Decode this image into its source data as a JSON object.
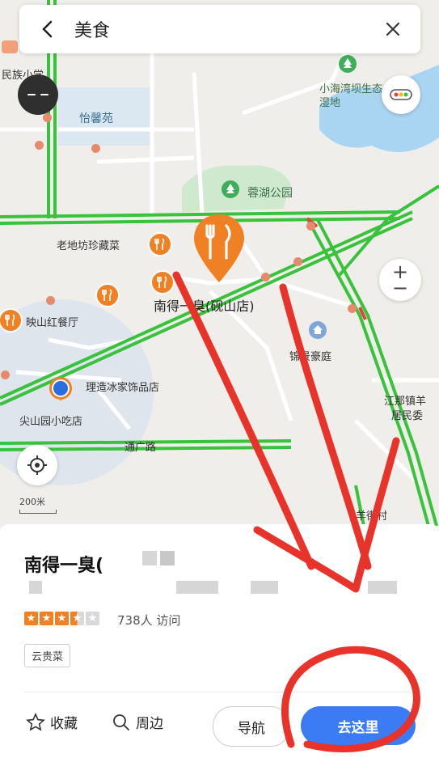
{
  "search": {
    "query": "美食"
  },
  "map": {
    "labels": {
      "school": "民族小学",
      "park_area": "怡馨苑",
      "wetland": "小海湾坝生态湿地",
      "lake_park": "蓉湖公园",
      "restaurant1": "老地坊珍藏菜",
      "selected": "南得一臭(砚山店)",
      "restaurant2": "映山红餐厅",
      "residence": "锦景豪庭",
      "shop": "理造冰家饰品店",
      "snack": "尖山园小吃店",
      "road": "通广路",
      "town": "江那镇羊",
      "village_area": "居民委",
      "village": "羊街村"
    },
    "scale": "200米",
    "zoom_plus": "+",
    "zoom_minus": "−"
  },
  "sheet": {
    "title": "南得一臭(",
    "rating": 3.5,
    "visits": "738人 访问",
    "tag": "云贵菜",
    "actions": {
      "favorite": "收藏",
      "nearby": "周边",
      "navigate": "导航",
      "go": "去这里"
    }
  },
  "colors": {
    "accent": "#3b7cf5",
    "poi": "#f08024",
    "road": "#39c23b",
    "star": "#f08024",
    "scribble": "#e8332a"
  },
  "icons": [
    "back-icon",
    "close-icon",
    "avatar-icon",
    "traffic-icon",
    "locate-icon",
    "restaurant-icon",
    "tree-icon",
    "home-icon",
    "star-outline-icon",
    "search-icon",
    "location-dot-icon"
  ]
}
